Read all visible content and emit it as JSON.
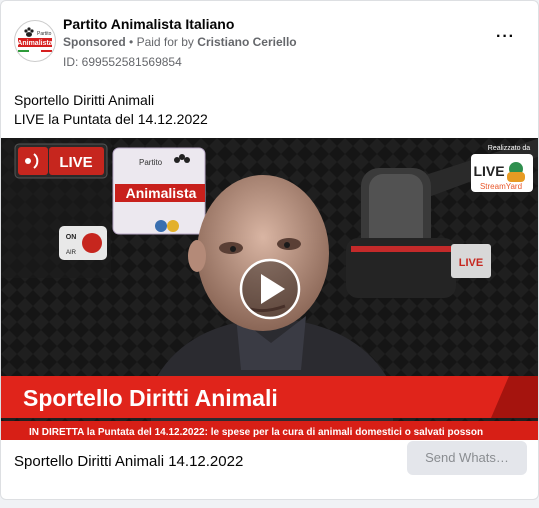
{
  "ad": {
    "page_name": "Partito Animalista Italiano",
    "sponsored_label": "Sponsored",
    "separator": "•",
    "paid_for_prefix": "Paid for by",
    "paid_for_name": "Cristiano Ceriello",
    "ad_id": "ID: 699552581569854",
    "more_label": "···",
    "logo_top": "Partito",
    "logo_main": "Animalista"
  },
  "caption": {
    "line1": "Sportello Diritti Animali",
    "line2": "LIVE la Puntata del 14.12.2022"
  },
  "video": {
    "live_badge": "LIVE",
    "onair_on": "ON",
    "onair_air": "AIR",
    "poster_top": "Partito",
    "poster_main": "Animalista",
    "realizzato": "Realizzato da",
    "streamyard_live": "LIVE",
    "streamyard_name": "StreamYard",
    "right_live": "LIVE",
    "banner_title": "Sportello Diritti Animali",
    "ticker": "IN DIRETTA la Puntata del 14.12.2022: le spese per la cura di animali domestici o salvati posson"
  },
  "footer": {
    "title": "Sportello Diritti Animali 14.12.2022",
    "button": "Send Whats…"
  },
  "colors": {
    "banner_red": "#e0241b",
    "ticker_red": "#d71f16",
    "muted_text": "#65676b"
  }
}
